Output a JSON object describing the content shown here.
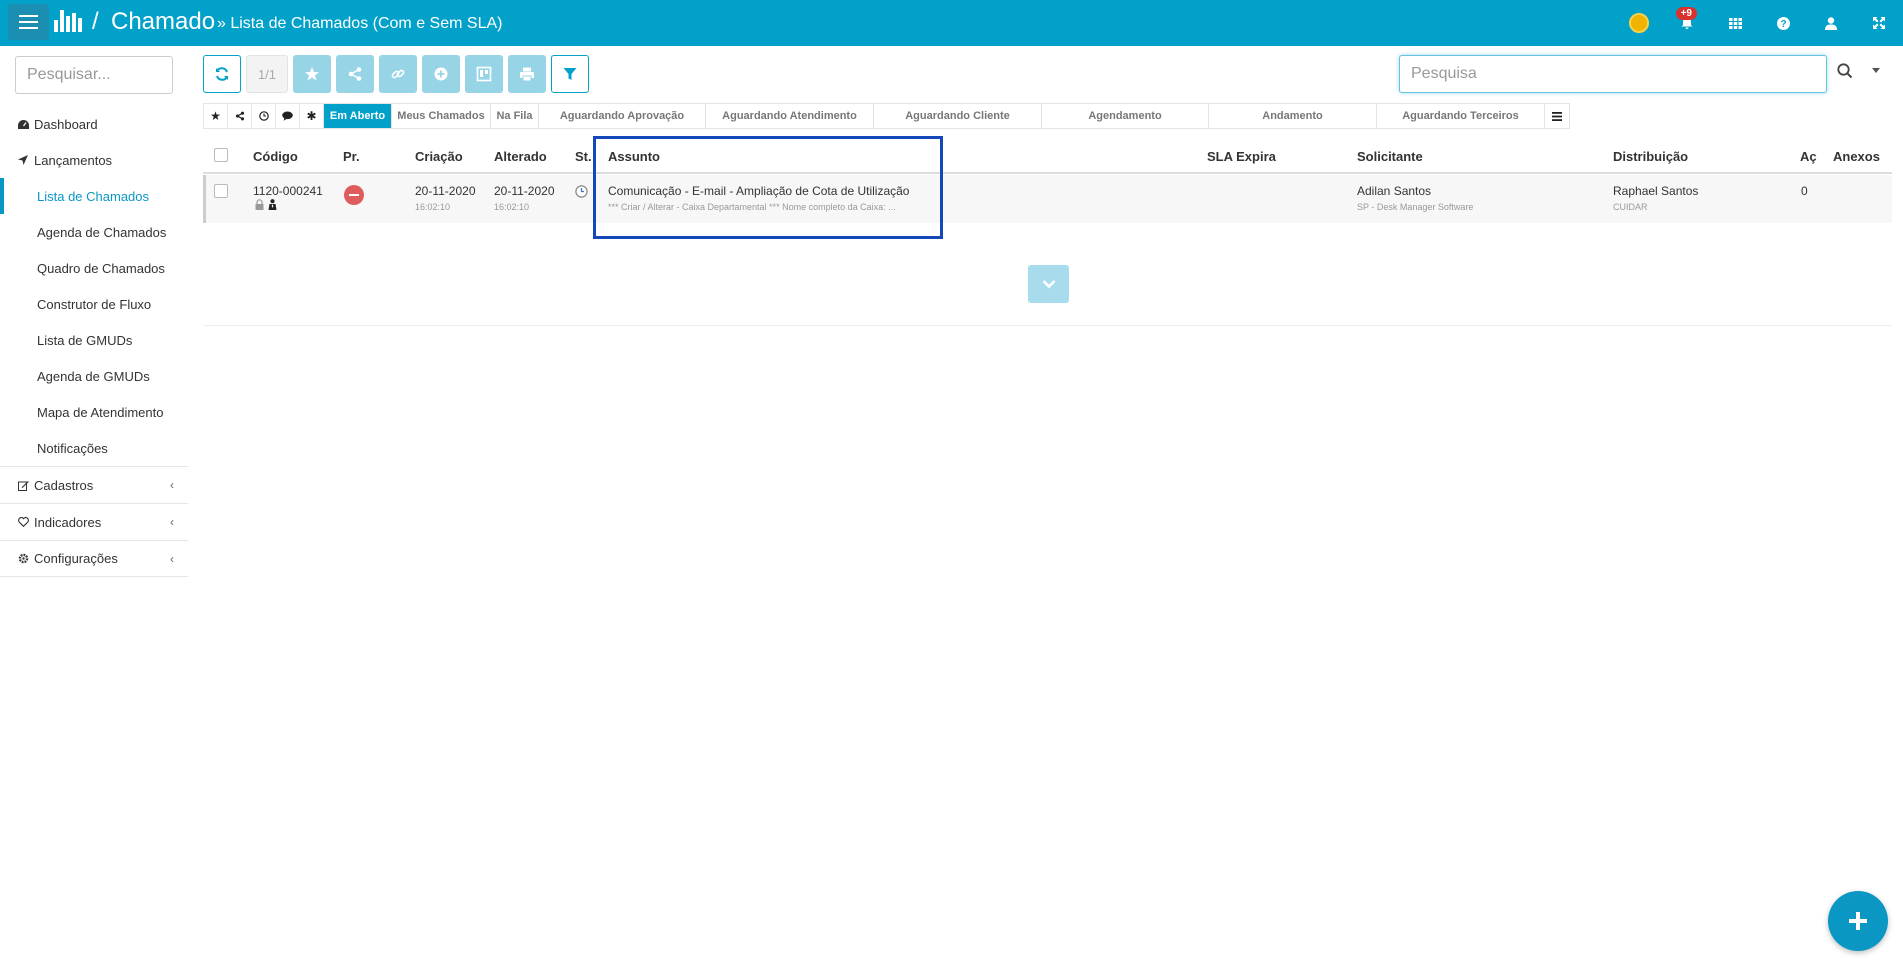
{
  "header": {
    "separator": "/",
    "app_title": "Chamado",
    "page_title": "» Lista de Chamados (Com e Sem SLA)",
    "notification_count": "+9",
    "colors": {
      "bar": "#02a1c9",
      "badge": "#d9312b"
    }
  },
  "sidebar": {
    "search_placeholder": "Pesquisar...",
    "items": [
      {
        "label": "Dashboard",
        "icon": "dashboard-icon"
      },
      {
        "label": "Lançamentos",
        "icon": "send-icon"
      },
      {
        "label": "Lista de Chamados"
      },
      {
        "label": "Agenda de Chamados"
      },
      {
        "label": "Quadro de Chamados"
      },
      {
        "label": "Construtor de Fluxo"
      },
      {
        "label": "Lista de GMUDs"
      },
      {
        "label": "Agenda de GMUDs"
      },
      {
        "label": "Mapa de Atendimento"
      },
      {
        "label": "Notificações"
      },
      {
        "label": "Cadastros",
        "icon": "edit-icon"
      },
      {
        "label": "Indicadores",
        "icon": "heart-icon"
      },
      {
        "label": "Configurações",
        "icon": "gear-icon"
      }
    ]
  },
  "toolbar": {
    "page_indicator": "1/1",
    "search_placeholder": "Pesquisa"
  },
  "filters": {
    "tabs": [
      "Em Aberto",
      "Meus Chamados",
      "Na Fila",
      "Aguardando Aprovação",
      "Aguardando Atendimento",
      "Aguardando Cliente",
      "Agendamento",
      "Andamento",
      "Aguardando Terceiros"
    ]
  },
  "table": {
    "columns": [
      "Código",
      "Pr.",
      "Criação",
      "Alterado",
      "St.",
      "Assunto",
      "SLA Expira",
      "Solicitante",
      "Distribuição",
      "Aç",
      "Anexos"
    ],
    "rows": [
      {
        "codigo": "1120-000241",
        "criacao_date": "20-11-2020",
        "criacao_time": "16:02:10",
        "alterado_date": "20-11-2020",
        "alterado_time": "16:02:10",
        "assunto": "Comunicação - E-mail - Ampliação de Cota de Utilização",
        "assunto_detail": "*** Criar / Alterar - Caixa Departamental *** Nome completo da Caixa:  ...",
        "solicitante": "Adilan Santos",
        "solicitante_org": "SP - Desk Manager Software",
        "distribuicao": "Raphael Santos",
        "distribuicao_group": "CUIDAR",
        "acoes": "0"
      }
    ]
  }
}
